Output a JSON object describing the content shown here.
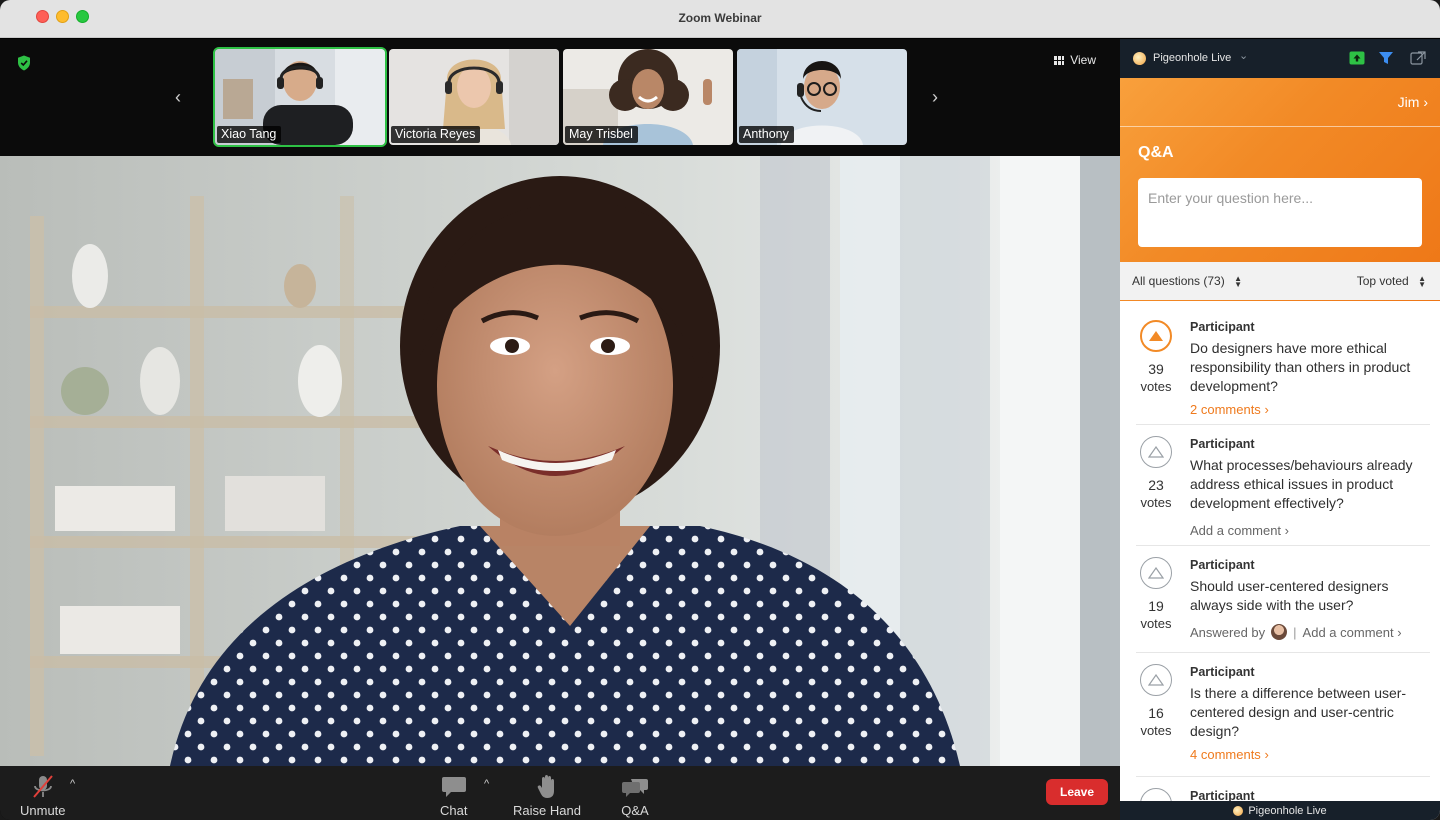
{
  "window": {
    "title": "Zoom Webinar"
  },
  "strip": {
    "view_label": "View",
    "participants": [
      {
        "name": "Xiao Tang",
        "active": true
      },
      {
        "name": "Victoria Reyes",
        "active": false
      },
      {
        "name": "May Trisbel",
        "active": false
      },
      {
        "name": "Anthony",
        "active": false
      }
    ]
  },
  "toolbar": {
    "unmute": "Unmute",
    "chat": "Chat",
    "raise_hand": "Raise Hand",
    "qa": "Q&A",
    "leave": "Leave"
  },
  "panel": {
    "app_name": "Pigeonhole Live",
    "user": "Jim",
    "section_title": "Q&A",
    "input_placeholder": "Enter your question here...",
    "filter_all": "All questions (73)",
    "filter_sort": "Top voted",
    "questions": [
      {
        "author": "Participant",
        "votes": "39",
        "votes_label": "votes",
        "text": "Do designers have more ethical responsibility than others in product development?",
        "link": "2 comments",
        "voted": true
      },
      {
        "author": "Participant",
        "votes": "23",
        "votes_label": "votes",
        "text": "What processes/behaviours already address ethical issues in product development effectively?",
        "link": "Add a comment",
        "voted": false
      },
      {
        "author": "Participant",
        "votes": "19",
        "votes_label": "votes",
        "text": "Should user-centered designers always side with the user?",
        "answered_by": "Answered by",
        "link": "Add a comment",
        "voted": false
      },
      {
        "author": "Participant",
        "votes": "16",
        "votes_label": "votes",
        "text": "Is there a difference between user-centered design and user-centric design?",
        "link": "4 comments",
        "voted": false
      },
      {
        "author": "Participant"
      }
    ],
    "footer": "Pigeonhole Live"
  },
  "colors": {
    "accent_orange": "#f28a26",
    "leave_red": "#d92d2d",
    "active_green": "#2ec145",
    "panel_dark": "#17202a"
  }
}
